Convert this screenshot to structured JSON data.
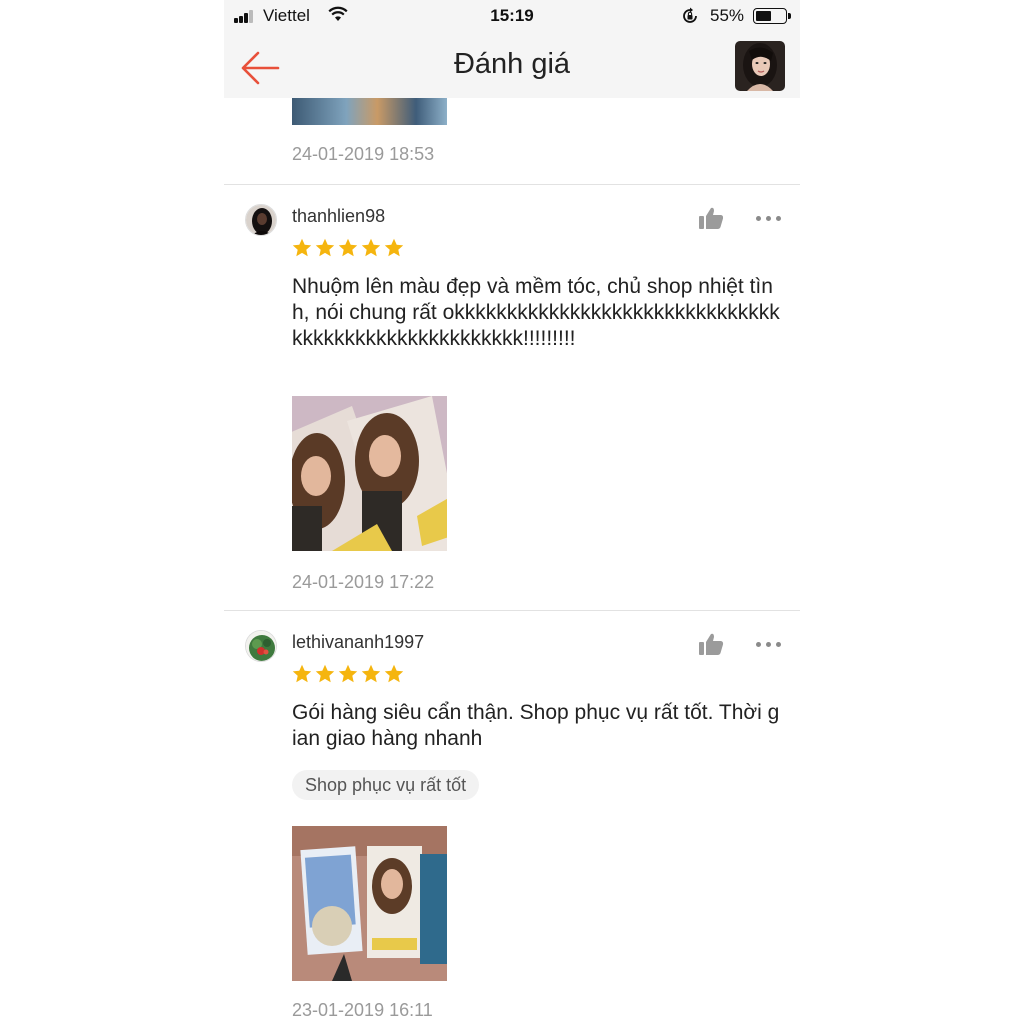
{
  "status_bar": {
    "carrier": "Viettel",
    "time": "15:19",
    "battery_percent": "55%",
    "battery_level": 0.55,
    "icons": [
      "signal-icon",
      "wifi-icon",
      "rotation-lock-icon",
      "battery-icon"
    ]
  },
  "header": {
    "title": "Đánh giá",
    "back_icon": "arrow-left-icon",
    "accent_color": "#e8503a"
  },
  "previous_review": {
    "date": "24-01-2019 18:53"
  },
  "reviews": [
    {
      "username": "thanhlien98",
      "rating": 5,
      "text": "Nhuộm lên màu đẹp và mềm tóc, chủ shop nhiệt tình, nói chung rất okkkkkkkkkkkkkkkkkkkkkkkkkkkkkkkkkkkkkkkkkkkkkkkkkkkkk!!!!!!!!!",
      "tags": [],
      "date": "24-01-2019 17:22"
    },
    {
      "username": "lethivananh1997",
      "rating": 5,
      "text": "Gói hàng siêu cẩn thận. Shop phục vụ rất tốt. Thời gian giao hàng nhanh",
      "tags": [
        "Shop phục vụ rất tốt"
      ],
      "date": "23-01-2019 16:11"
    }
  ],
  "colors": {
    "star": "#f5b50f",
    "date_text": "#9a9a9a",
    "divider": "#e2e2e2",
    "header_bg": "#f5f5f5"
  }
}
